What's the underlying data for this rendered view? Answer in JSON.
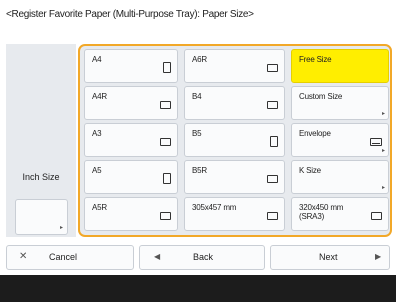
{
  "header": {
    "title": "<Register Favorite Paper (Multi-Purpose Tray): Paper Size>"
  },
  "inch": {
    "label": "Inch Size",
    "sub_icon": "triangle-right-small-icon"
  },
  "grid": {
    "col1": [
      {
        "label": "A4",
        "orientation": "portrait"
      },
      {
        "label": "A4R",
        "orientation": "landscape"
      },
      {
        "label": "A3",
        "orientation": "landscape"
      },
      {
        "label": "A5",
        "orientation": "portrait"
      },
      {
        "label": "A5R",
        "orientation": "landscape"
      }
    ],
    "col2": [
      {
        "label": "A6R",
        "orientation": "landscape"
      },
      {
        "label": "B4",
        "orientation": "landscape"
      },
      {
        "label": "B5",
        "orientation": "portrait"
      },
      {
        "label": "B5R",
        "orientation": "landscape"
      },
      {
        "label": "305x457 mm",
        "orientation": "landscape"
      }
    ],
    "col3": [
      {
        "label": "Free Size",
        "selected": true
      },
      {
        "label": "Custom Size",
        "has_submenu": true
      },
      {
        "label": "Envelope",
        "has_submenu": true,
        "icon": "envelope-icon"
      },
      {
        "label": "K Size",
        "has_submenu": true
      },
      {
        "label": "320x450 mm (SRA3)",
        "orientation": "landscape"
      }
    ]
  },
  "footer": {
    "cancel_label": "Cancel",
    "cancel_icon": "x-icon",
    "back_label": "Back",
    "back_icon": "triangle-left-icon",
    "next_label": "Next",
    "next_icon": "triangle-right-icon"
  },
  "colors": {
    "selected": "#ffee00",
    "frame": "#f2a828",
    "panel": "#e7eaee",
    "bottom_strip": "#1c1c1c"
  }
}
